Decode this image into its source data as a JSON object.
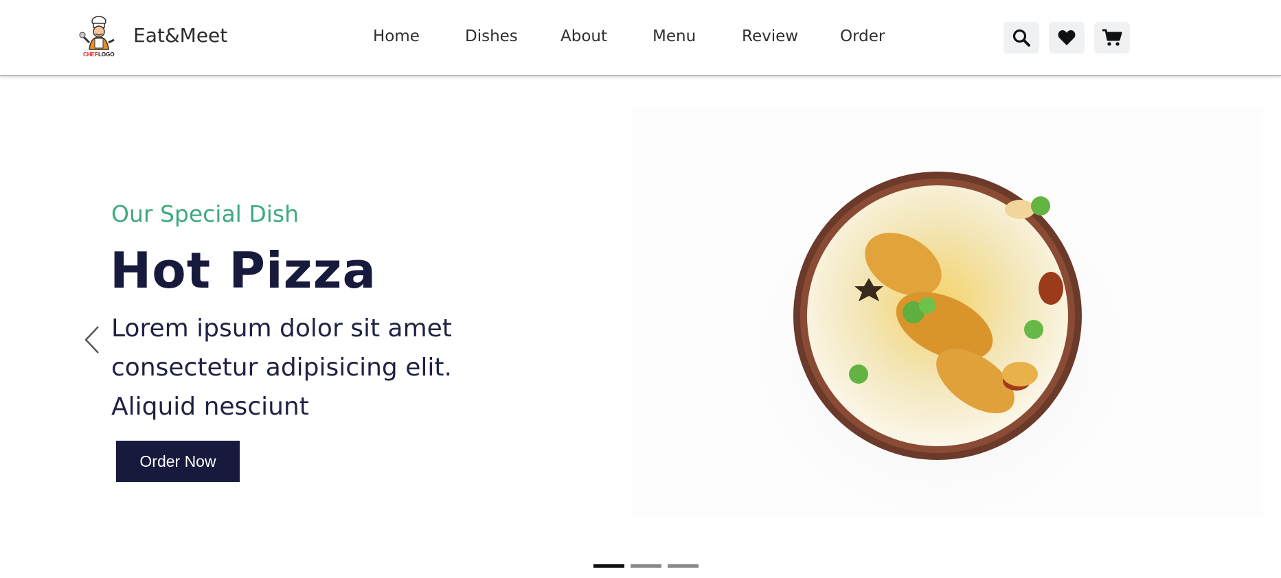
{
  "header": {
    "brand": "Eat&Meet",
    "logo_text": "CHEF LOGO",
    "nav": [
      "Home",
      "Dishes",
      "About",
      "Menu",
      "Review",
      "Order"
    ],
    "icons": [
      "search-icon",
      "heart-icon",
      "cart-icon"
    ]
  },
  "hero": {
    "subtitle": "Our Special Dish",
    "title": "Hot Pizza",
    "description": "Lorem ipsum dolor sit amet consectetur adipisicing elit. Aliquid nesciunt",
    "cta": "Order Now",
    "slides": 3,
    "active_slide": 1
  },
  "colors": {
    "accent_green": "#3fa97c",
    "dark_navy": "#171a3c",
    "icon_bg": "#f0f1f3"
  }
}
